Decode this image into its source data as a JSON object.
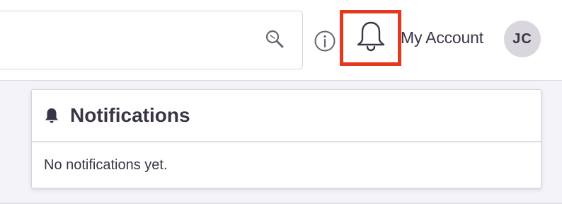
{
  "header": {
    "search": {
      "value": "",
      "icon": "search-icon"
    },
    "info_icon": "info-icon",
    "bell_icon": "bell-icon",
    "account_label": "My Account",
    "avatar_initials": "JC"
  },
  "notifications": {
    "title": "Notifications",
    "header_icon": "bell-filled-icon",
    "empty_message": "No notifications yet."
  },
  "colors": {
    "highlight": "#e5391f",
    "text": "#3b3447",
    "avatar_bg": "#d9d7dd"
  }
}
